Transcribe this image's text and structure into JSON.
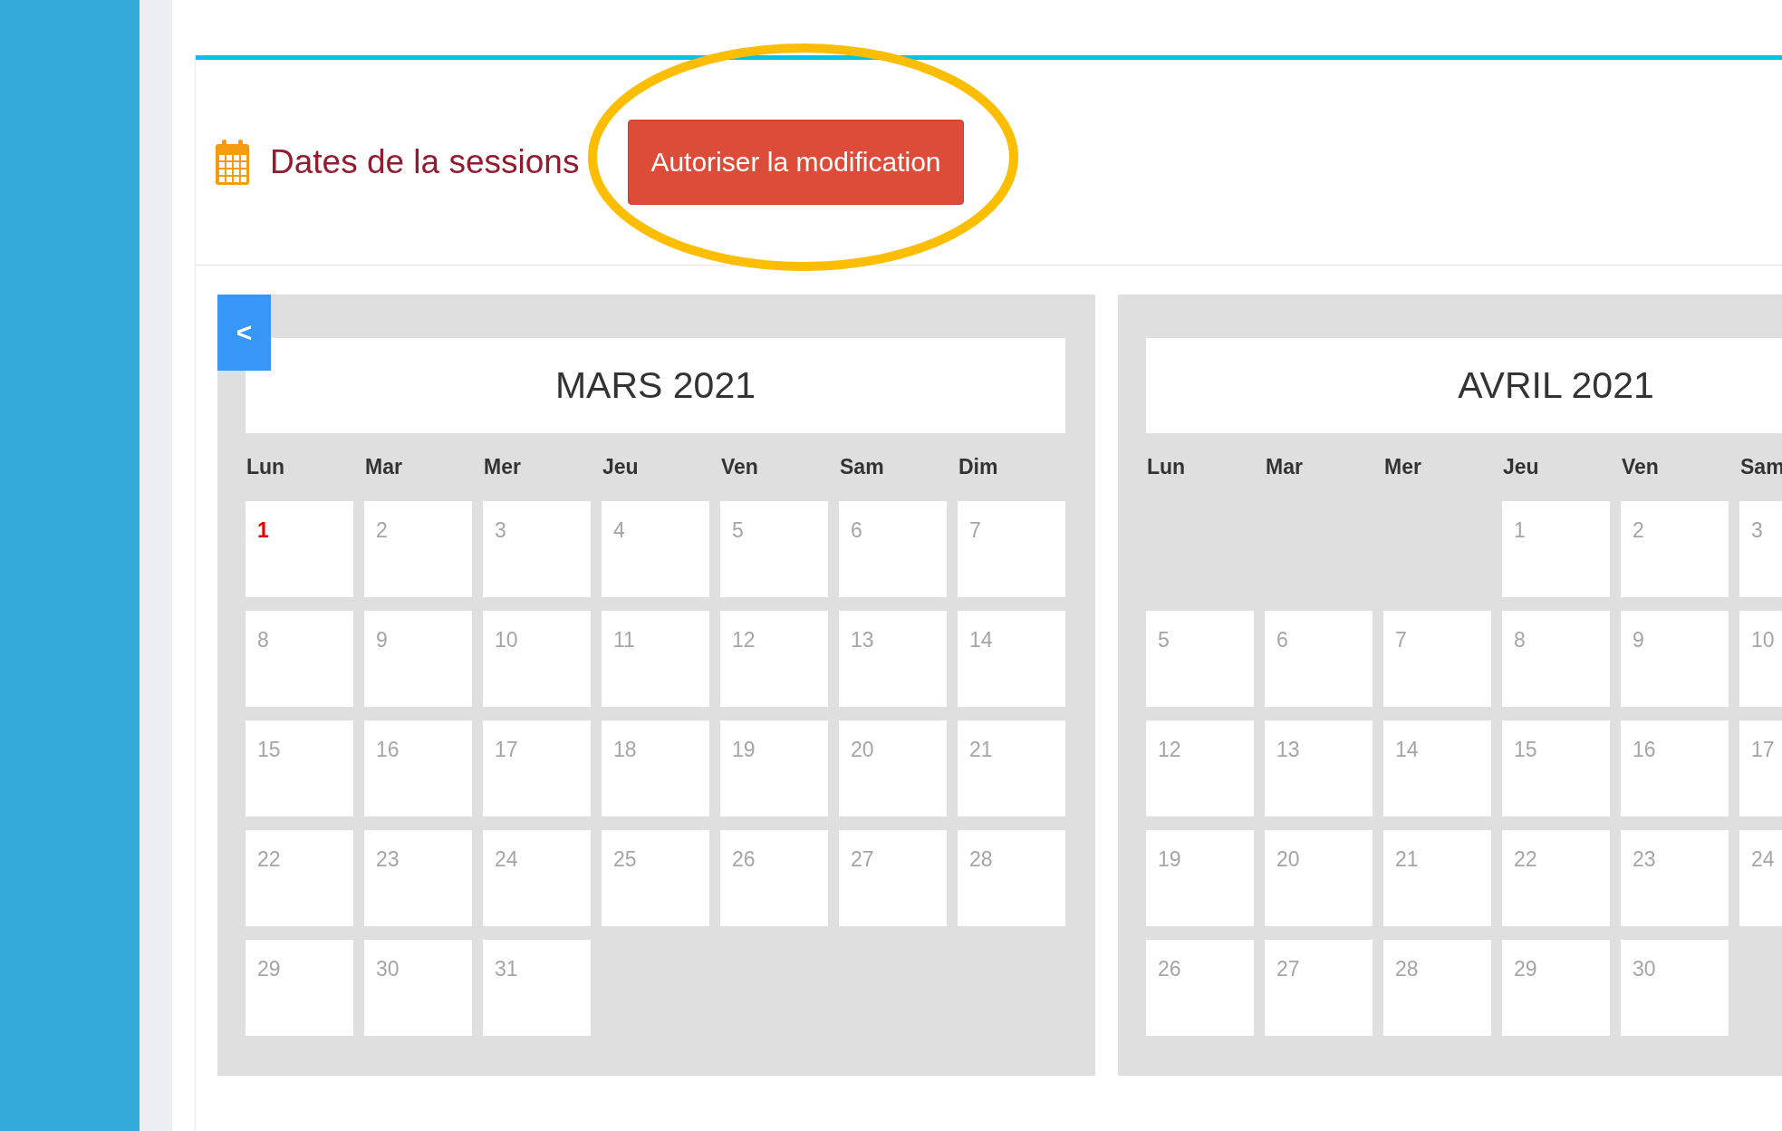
{
  "header": {
    "title": "Dates de la sessions",
    "button": {
      "label": "Autoriser la modification",
      "highlighted": true
    }
  },
  "calendars": [
    {
      "month": "MARS 2021",
      "nav_button": "<",
      "weekdays": [
        "Lun",
        "Mar",
        "Mer",
        "Jeu",
        "Ven",
        "Sam",
        "Dim"
      ],
      "weeks": [
        [
          {
            "kind": "day",
            "label": "1",
            "today": true
          },
          {
            "kind": "day",
            "label": "2",
            "today": false
          },
          {
            "kind": "day",
            "label": "3",
            "today": false
          },
          {
            "kind": "day",
            "label": "4",
            "today": false
          },
          {
            "kind": "day",
            "label": "5",
            "today": false
          },
          {
            "kind": "day",
            "label": "6",
            "today": false
          },
          {
            "kind": "day",
            "label": "7",
            "today": false
          }
        ],
        [
          {
            "kind": "day",
            "label": "8",
            "today": false
          },
          {
            "kind": "day",
            "label": "9",
            "today": false
          },
          {
            "kind": "day",
            "label": "10",
            "today": false
          },
          {
            "kind": "day",
            "label": "11",
            "today": false
          },
          {
            "kind": "day",
            "label": "12",
            "today": false
          },
          {
            "kind": "day",
            "label": "13",
            "today": false
          },
          {
            "kind": "day",
            "label": "14",
            "today": false
          }
        ],
        [
          {
            "kind": "day",
            "label": "15",
            "today": false
          },
          {
            "kind": "day",
            "label": "16",
            "today": false
          },
          {
            "kind": "day",
            "label": "17",
            "today": false
          },
          {
            "kind": "day",
            "label": "18",
            "today": false
          },
          {
            "kind": "day",
            "label": "19",
            "today": false
          },
          {
            "kind": "day",
            "label": "20",
            "today": false
          },
          {
            "kind": "day",
            "label": "21",
            "today": false
          }
        ],
        [
          {
            "kind": "day",
            "label": "22",
            "today": false
          },
          {
            "kind": "day",
            "label": "23",
            "today": false
          },
          {
            "kind": "day",
            "label": "24",
            "today": false
          },
          {
            "kind": "day",
            "label": "25",
            "today": false
          },
          {
            "kind": "day",
            "label": "26",
            "today": false
          },
          {
            "kind": "day",
            "label": "27",
            "today": false
          },
          {
            "kind": "day",
            "label": "28",
            "today": false
          }
        ],
        [
          {
            "kind": "day",
            "label": "29",
            "today": false
          },
          {
            "kind": "day",
            "label": "30",
            "today": false
          },
          {
            "kind": "day",
            "label": "31",
            "today": false
          }
        ]
      ]
    },
    {
      "month": "AVRIL 2021",
      "weekdays": [
        "Lun",
        "Mar",
        "Mer",
        "Jeu",
        "Ven",
        "Sam"
      ],
      "weeks": [
        [
          {
            "kind": "blank"
          },
          {
            "kind": "blank"
          },
          {
            "kind": "blank"
          },
          {
            "kind": "day",
            "label": "1",
            "today": false
          },
          {
            "kind": "day",
            "label": "2",
            "today": false
          },
          {
            "kind": "day",
            "label": "3",
            "today": false
          }
        ],
        [
          {
            "kind": "day",
            "label": "5",
            "today": false
          },
          {
            "kind": "day",
            "label": "6",
            "today": false
          },
          {
            "kind": "day",
            "label": "7",
            "today": false
          },
          {
            "kind": "day",
            "label": "8",
            "today": false
          },
          {
            "kind": "day",
            "label": "9",
            "today": false
          },
          {
            "kind": "day",
            "label": "10",
            "today": false
          }
        ],
        [
          {
            "kind": "day",
            "label": "12",
            "today": false
          },
          {
            "kind": "day",
            "label": "13",
            "today": false
          },
          {
            "kind": "day",
            "label": "14",
            "today": false
          },
          {
            "kind": "day",
            "label": "15",
            "today": false
          },
          {
            "kind": "day",
            "label": "16",
            "today": false
          },
          {
            "kind": "day",
            "label": "17",
            "today": false
          }
        ],
        [
          {
            "kind": "day",
            "label": "19",
            "today": false
          },
          {
            "kind": "day",
            "label": "20",
            "today": false
          },
          {
            "kind": "day",
            "label": "21",
            "today": false
          },
          {
            "kind": "day",
            "label": "22",
            "today": false
          },
          {
            "kind": "day",
            "label": "23",
            "today": false
          },
          {
            "kind": "day",
            "label": "24",
            "today": false
          }
        ],
        [
          {
            "kind": "day",
            "label": "26",
            "today": false
          },
          {
            "kind": "day",
            "label": "27",
            "today": false
          },
          {
            "kind": "day",
            "label": "28",
            "today": false
          },
          {
            "kind": "day",
            "label": "29",
            "today": false
          },
          {
            "kind": "day",
            "label": "30",
            "today": false
          }
        ]
      ]
    }
  ]
}
